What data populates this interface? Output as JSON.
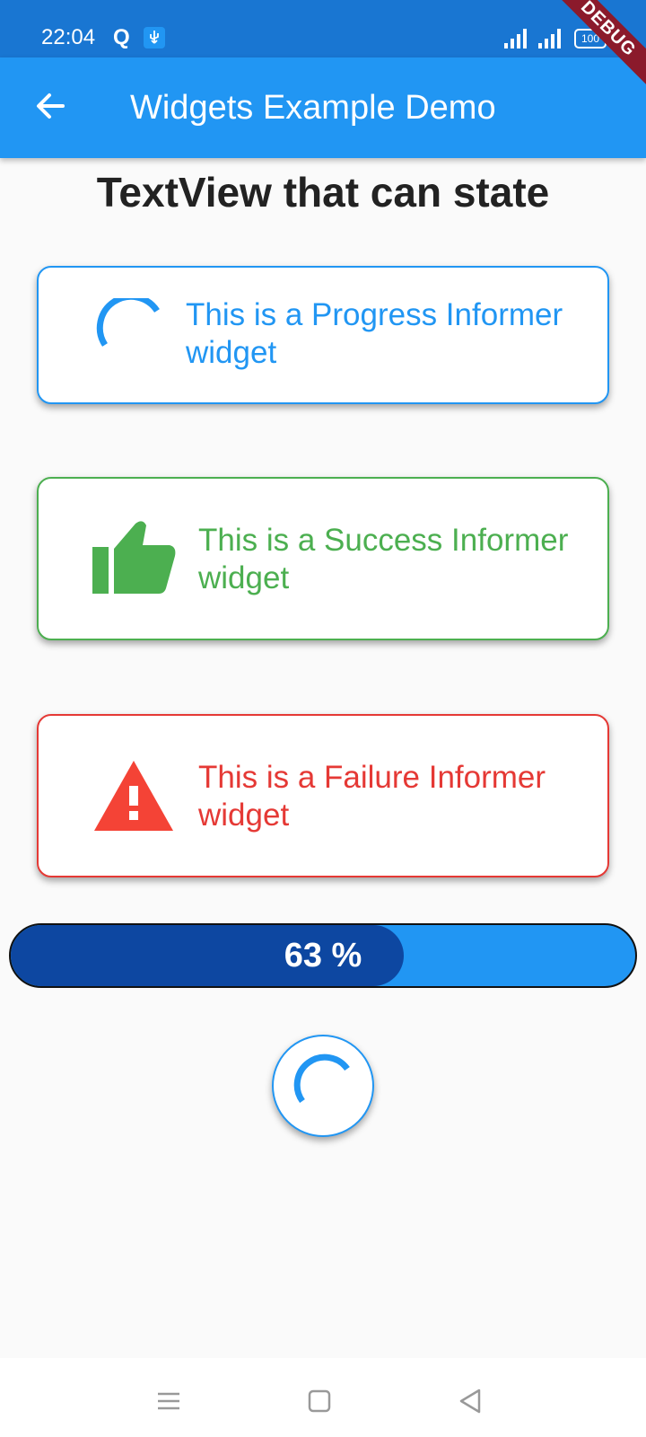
{
  "status_bar": {
    "time": "22:04",
    "q_label": "Q",
    "battery": "100"
  },
  "debug_banner": "DEBUG",
  "app_bar": {
    "title": "Widgets Example Demo",
    "back_icon": "arrow-back-icon"
  },
  "page": {
    "heading": "TextView that can state"
  },
  "informers": [
    {
      "type": "progress",
      "text": "This is a Progress Informer widget",
      "color": "#2196f3",
      "icon": "progress-spinner-icon"
    },
    {
      "type": "success",
      "text": "This is a Success Informer widget",
      "color": "#4caf50",
      "icon": "thumb-up-icon"
    },
    {
      "type": "failure",
      "text": "This is a Failure Informer widget",
      "color": "#e53935",
      "icon": "warning-icon"
    }
  ],
  "progress": {
    "value": 0.63,
    "label": "63 %",
    "fill_color": "#0d47a1",
    "track_color": "#2196f3"
  },
  "colors": {
    "primary": "#2196f3",
    "status_bar": "#1976d2"
  },
  "nav_bar": {
    "menu_icon": "menu-icon",
    "home_icon": "home-square-icon",
    "back_icon": "back-triangle-icon"
  }
}
